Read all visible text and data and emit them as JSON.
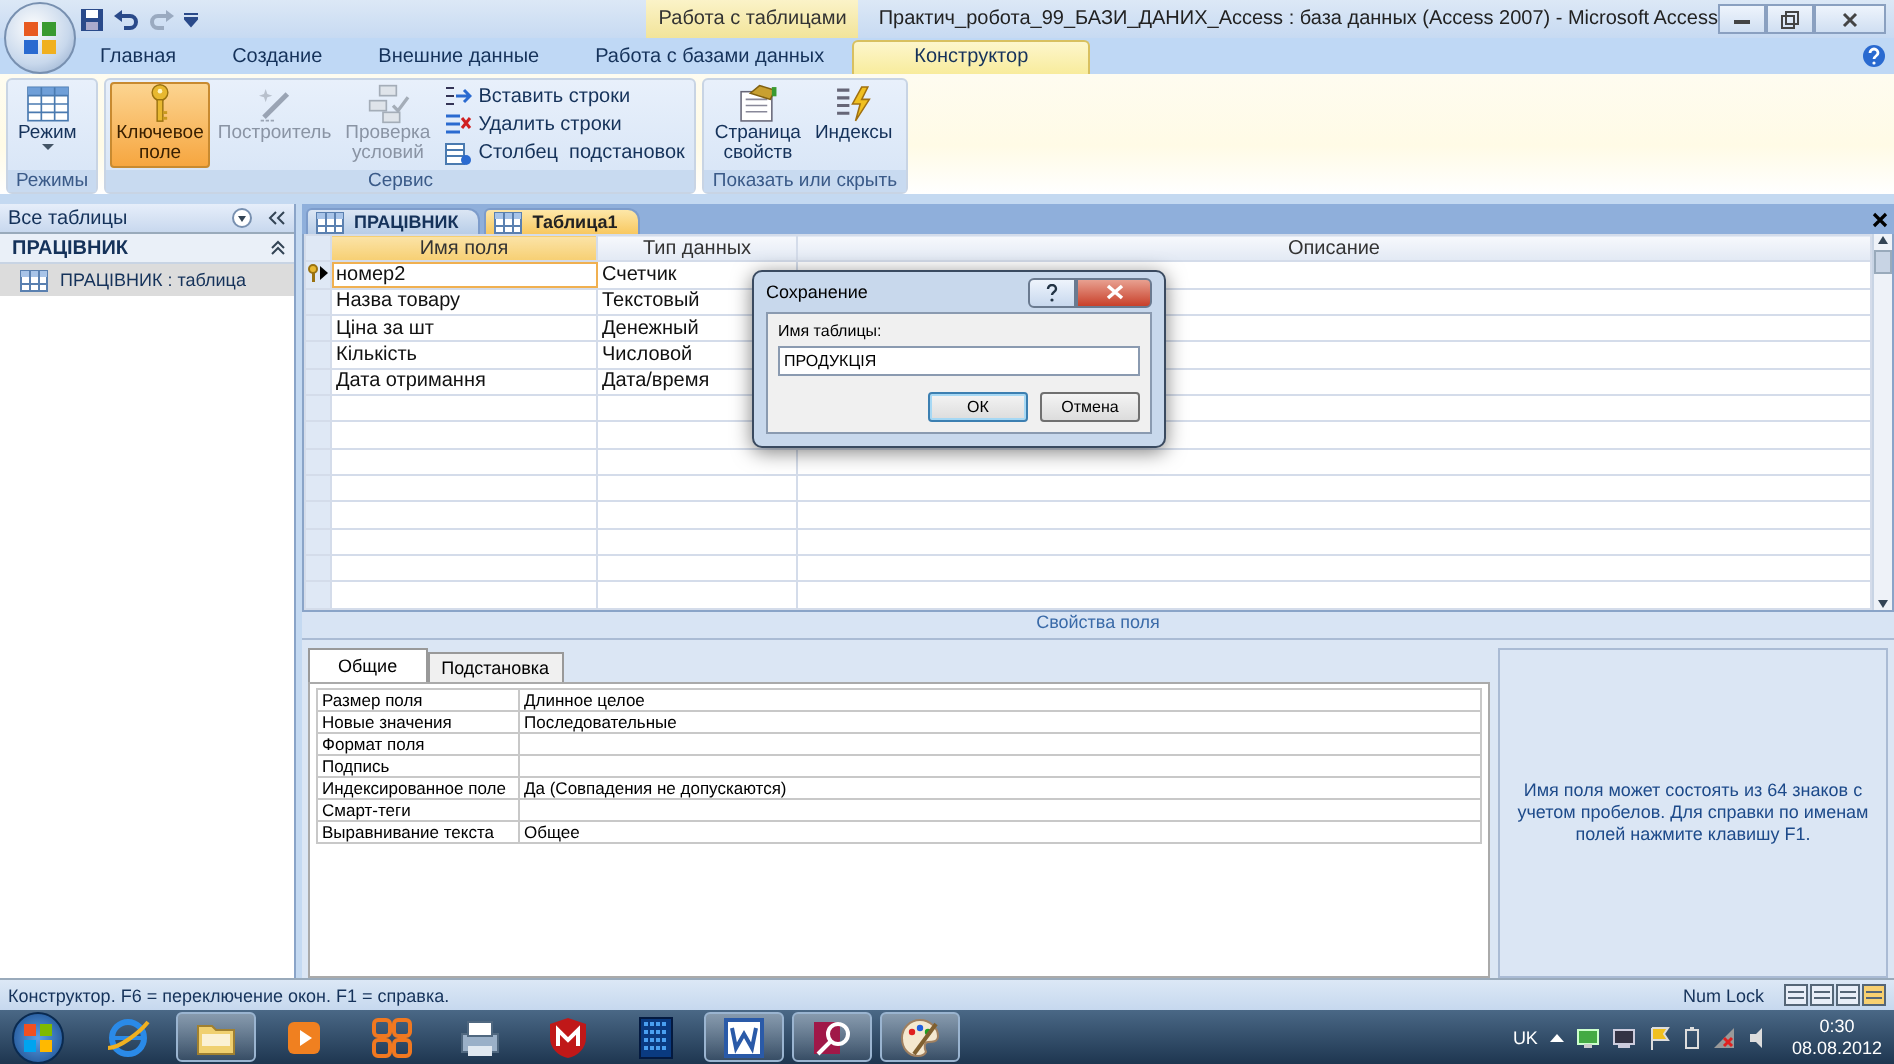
{
  "title_bar": {
    "contextual_tab": "Работа с таблицами",
    "title": "Практич_робота_99_БАЗИ_ДАНИХ_Access : база данных (Access 2007)  -  Microsoft Access"
  },
  "ribbon_tabs": [
    {
      "label": "Главная",
      "selected": false
    },
    {
      "label": "Создание",
      "selected": false
    },
    {
      "label": "Внешние данные",
      "selected": false
    },
    {
      "label": "Работа с базами данных",
      "selected": false
    },
    {
      "label": "Конструктор",
      "selected": true
    }
  ],
  "ribbon_groups": [
    {
      "label": "Режимы",
      "buttons": [
        {
          "kind": "large",
          "label": "Режим",
          "active": false,
          "disabled": false
        }
      ]
    },
    {
      "label": "Сервис",
      "buttons": [
        {
          "kind": "large",
          "label": "Ключевое поле",
          "active": true,
          "disabled": false
        },
        {
          "kind": "large",
          "label": "Построитель",
          "active": false,
          "disabled": true
        },
        {
          "kind": "large",
          "label": "Проверка условий",
          "active": false,
          "disabled": true
        },
        {
          "kind": "small",
          "label": "Вставить строки",
          "active": false,
          "disabled": false
        },
        {
          "kind": "small",
          "label": "Удалить строки",
          "active": false,
          "disabled": false
        },
        {
          "kind": "small",
          "label": "Столбец  подстановок",
          "active": false,
          "disabled": false
        }
      ]
    },
    {
      "label": "Показать или скрыть",
      "buttons": [
        {
          "kind": "large",
          "label": "Страница свойств",
          "active": false,
          "disabled": false
        },
        {
          "kind": "large",
          "label": "Индексы",
          "active": false,
          "disabled": false
        }
      ]
    }
  ],
  "nav_pane": {
    "header": "Все таблицы",
    "groups": [
      {
        "label": "ПРАЦІВНИК",
        "expanded": true,
        "children": [
          {
            "label": "ПРАЦІВНИК : таблица",
            "selected": true
          }
        ]
      }
    ]
  },
  "document_tabs": [
    {
      "label": "ПРАЦІВНИК",
      "selected": false
    },
    {
      "label": "Таблица1",
      "selected": true
    }
  ],
  "design_grid": {
    "columns": [
      "Имя поля",
      "Тип данных",
      "Описание"
    ],
    "rows": [
      {
        "name": "номер2",
        "type": "Счетчик",
        "primary_key": true,
        "selected": true
      },
      {
        "name": "Назва товару",
        "type": "Текстовый",
        "primary_key": false,
        "selected": false
      },
      {
        "name": "Ціна за шт",
        "type": "Денежный",
        "primary_key": false,
        "selected": false
      },
      {
        "name": "Кількість",
        "type": "Числовой",
        "primary_key": false,
        "selected": false
      },
      {
        "name": "Дата отримання",
        "type": "Дата/время",
        "primary_key": false,
        "selected": false
      }
    ]
  },
  "field_properties": {
    "title": "Свойства поля",
    "tabs": [
      {
        "label": "Общие",
        "selected": true
      },
      {
        "label": "Подстановка",
        "selected": false
      }
    ],
    "rows": [
      {
        "label": "Размер поля",
        "value": "Длинное целое"
      },
      {
        "label": "Новые значения",
        "value": "Последовательные"
      },
      {
        "label": "Формат поля"
      },
      {
        "label": "Подпись"
      },
      {
        "label": "Индексированное поле",
        "value": "Да (Совпадения не допускаются)"
      },
      {
        "label": "Смарт-теги"
      },
      {
        "label": "Выравнивание текста",
        "value": "Общее"
      }
    ],
    "help_text": "Имя поля может состоять из 64 знаков с учетом пробелов.  Для справки по именам полей нажмите клавишу F1."
  },
  "dialog": {
    "title": "Сохранение",
    "label": "Имя таблицы:",
    "value": "ПРОДУКЦІЯ",
    "buttons": [
      {
        "label": "ОК",
        "default": true
      },
      {
        "label": "Отмена",
        "default": false
      }
    ]
  },
  "status_bar": {
    "text": "Конструктор.  F6 = переключение окон.  F1 = справка.",
    "indicator": "Num Lock"
  },
  "taskbar": {
    "apps": [
      {
        "kind": "browser",
        "open": false
      },
      {
        "kind": "folder",
        "open": true
      },
      {
        "kind": "player",
        "open": false
      },
      {
        "kind": "tiles",
        "open": false
      },
      {
        "kind": "network",
        "open": false
      },
      {
        "kind": "shield",
        "open": false
      },
      {
        "kind": "calculator",
        "open": false
      },
      {
        "kind": "word",
        "open": true
      },
      {
        "kind": "access",
        "open": true
      },
      {
        "kind": "paint",
        "open": true
      }
    ],
    "language": "UK",
    "time": "0:30",
    "date": "08.08.2012"
  }
}
